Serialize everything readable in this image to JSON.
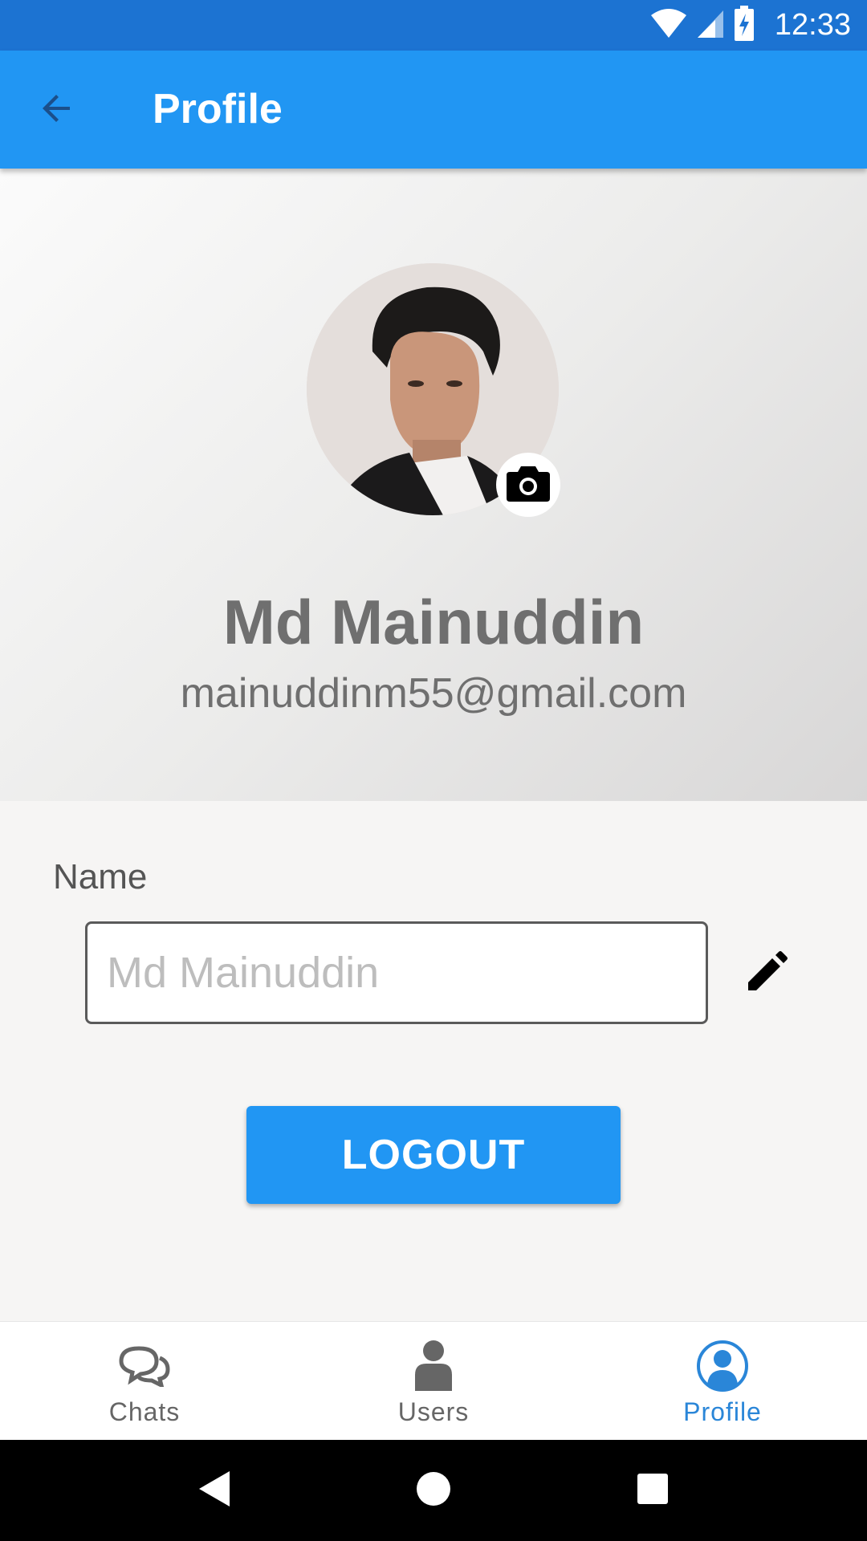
{
  "status_bar": {
    "time": "12:33",
    "icons": [
      "wifi-icon",
      "signal-icon",
      "battery-charging-icon"
    ]
  },
  "app_bar": {
    "title": "Profile",
    "back_icon": "arrow-left-icon"
  },
  "profile": {
    "name": "Md Mainuddin",
    "email": "mainuddinm55@gmail.com",
    "avatar_icon": "profile-photo",
    "camera_icon": "camera-icon"
  },
  "form": {
    "name_label": "Name",
    "name_placeholder": "Md Mainuddin",
    "edit_icon": "pencil-icon"
  },
  "logout_label": "LOGOUT",
  "bottom_nav": {
    "items": [
      {
        "label": "Chats",
        "icon": "chat-bubbles-icon",
        "active": false
      },
      {
        "label": "Users",
        "icon": "user-icon",
        "active": false
      },
      {
        "label": "Profile",
        "icon": "profile-circle-icon",
        "active": true
      }
    ]
  },
  "system_nav": {
    "icons": [
      "back-triangle-icon",
      "home-circle-icon",
      "recents-square-icon"
    ]
  },
  "colors": {
    "primary": "#2196f3",
    "status_bar": "#1c73d2",
    "active_nav": "#2a86d8"
  }
}
